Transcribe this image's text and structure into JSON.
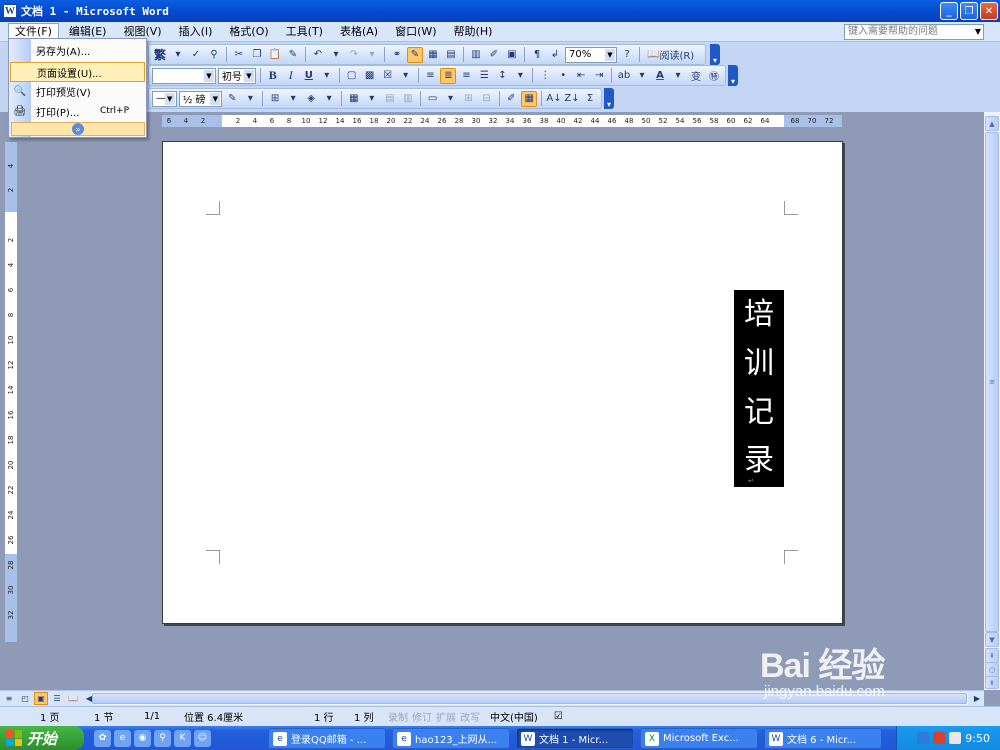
{
  "window": {
    "title": "文档 1 - Microsoft Word",
    "min": "_",
    "max": "❐",
    "close": "✕"
  },
  "menubar": {
    "items": [
      "文件(F)",
      "编辑(E)",
      "视图(V)",
      "插入(I)",
      "格式(O)",
      "工具(T)",
      "表格(A)",
      "窗口(W)",
      "帮助(H)"
    ],
    "help_placeholder": "键入需要帮助的问题"
  },
  "file_menu": {
    "items": [
      {
        "label": "另存为(A)...",
        "shortcut": ""
      },
      {
        "label": "页面设置(U)...",
        "shortcut": ""
      },
      {
        "label": "打印预览(V)",
        "shortcut": ""
      },
      {
        "label": "打印(P)...",
        "shortcut": "Ctrl+P"
      }
    ],
    "expand": "»"
  },
  "toolbar": {
    "zoom": "70%",
    "read_label": "阅读(R)",
    "font_size": "初号",
    "traditional": "繁",
    "line_weight": "½ 磅",
    "bold": "B",
    "italic": "I",
    "underline": "U"
  },
  "ruler": {
    "h_left": [
      "6",
      "4",
      "2"
    ],
    "h_main": [
      "2",
      "4",
      "6",
      "8",
      "10",
      "12",
      "14",
      "16",
      "18",
      "20",
      "22",
      "24",
      "26",
      "28",
      "30",
      "32",
      "34",
      "36",
      "38",
      "40",
      "42",
      "44",
      "46",
      "48",
      "50",
      "52",
      "54",
      "56",
      "58",
      "60",
      "62",
      "64"
    ],
    "h_right": [
      "68",
      "70",
      "72"
    ],
    "v_top": [
      "4",
      "2"
    ],
    "v_main": [
      "2",
      "4",
      "6",
      "8",
      "10",
      "12",
      "14",
      "16",
      "18",
      "20",
      "22",
      "24",
      "26",
      "28",
      "30",
      "32"
    ]
  },
  "document": {
    "vertical_text": [
      "培",
      "训",
      "记",
      "录"
    ],
    "para_mark": "↵"
  },
  "statusbar": {
    "page": "1 页",
    "section": "1 节",
    "pages": "1/1",
    "position": "位置 6.4厘米",
    "line": "1 行",
    "column": "1 列",
    "modes": [
      "录制",
      "修订",
      "扩展",
      "改写"
    ],
    "language": "中文(中国)"
  },
  "taskbar": {
    "start": "开始",
    "tasks": [
      {
        "label": "登录QQ邮箱 - ...",
        "icon": "e",
        "active": false
      },
      {
        "label": "hao123_上网从...",
        "icon": "e",
        "active": false
      },
      {
        "label": "文档 1 - Micr...",
        "icon": "W",
        "active": true
      },
      {
        "label": "Microsoft Exc...",
        "icon": "X",
        "active": false
      },
      {
        "label": "文档 6 - Micr...",
        "icon": "W",
        "active": false
      }
    ],
    "time": "9:50"
  },
  "watermark": {
    "brand": "Bai 经验",
    "url": "jingyan.baidu.com"
  }
}
